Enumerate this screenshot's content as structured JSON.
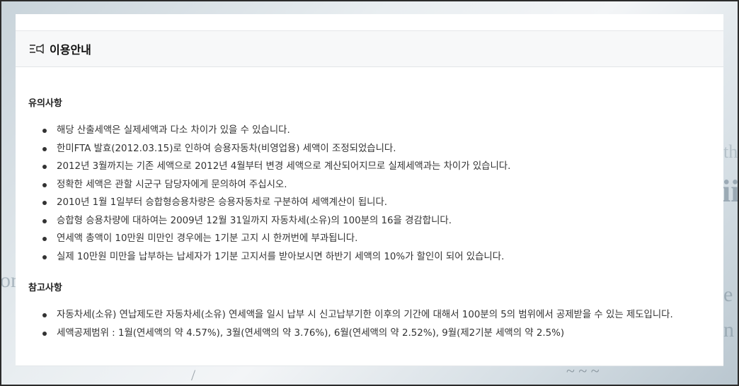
{
  "header": {
    "icon": "notice-list-icon",
    "title": "이용안내"
  },
  "sections": [
    {
      "title": "유의사항",
      "items": [
        "해당 산출세액은 실제세액과 다소 차이가 있을 수 있습니다.",
        "한미FTA 발효(2012.03.15)로 인하여 승용자동차(비영업용) 세액이 조정되었습니다.",
        "2012년 3월까지는 기존 세액으로 2012년 4월부터 변경 세액으로 계산되어지므로 실제세액과는 차이가 있습니다.",
        "정확한 세액은 관할 시군구 담당자에게 문의하여 주십시오.",
        "2010년 1월 1일부터 승합형승용차량은 승용자동차로 구분하여 세액계산이 됩니다.",
        "승합형 승용차량에 대하여는 2009년 12월 31일까지 자동차세(소유)의 100분의 16을 경감합니다.",
        "연세액 총액이 10만원 미만인 경우에는 1기분 고지 시 한꺼번에 부과됩니다.",
        "실제 10만원 미만을 납부하는 납세자가 1기분 고지서를 받아보시면 하반기 세액의 10%가 할인이 되어 있습니다."
      ]
    },
    {
      "title": "참고사항",
      "items": [
        "자동차세(소유) 연납제도란 자동차세(소유) 연세액을 일시 납부 시 신고납부기한 이후의 기간에 대해서 100분의 5의 범위에서 공제받을 수 있는 제도입니다.",
        "세액공제범위 : 1월(연세액의 약 4.57%), 3월(연세액의 약 3.76%), 6월(연세액의 약 2.52%), 9월(제2기분 세액의 약 2.5%)"
      ]
    }
  ]
}
